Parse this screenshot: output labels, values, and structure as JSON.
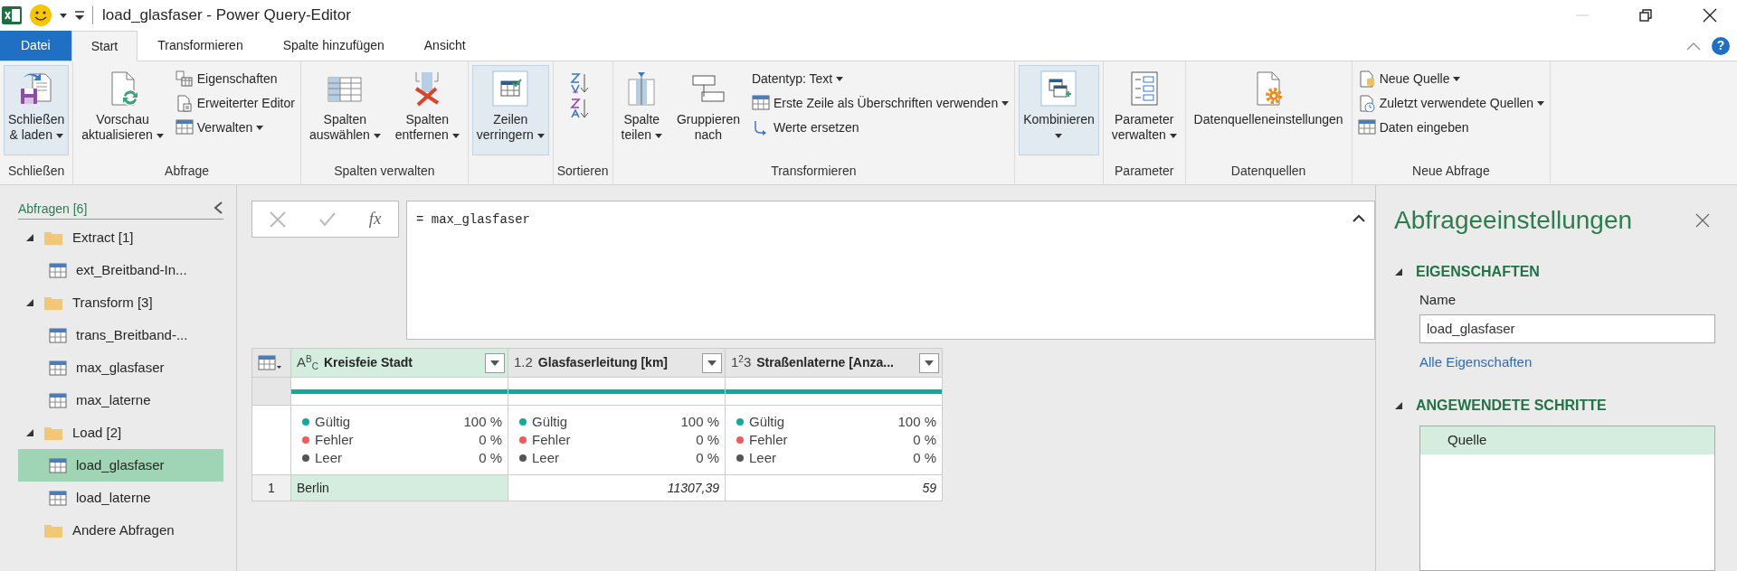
{
  "window": {
    "title": "load_glasfaser - Power Query-Editor"
  },
  "ribbon_tabs": [
    {
      "label": "Datei",
      "kind": "file",
      "selected": false
    },
    {
      "label": "Start",
      "kind": "tab",
      "selected": true
    },
    {
      "label": "Transformieren",
      "kind": "tab",
      "selected": false
    },
    {
      "label": "Spalte hinzufügen",
      "kind": "tab",
      "selected": false
    },
    {
      "label": "Ansicht",
      "kind": "tab",
      "selected": false
    }
  ],
  "help": "?",
  "ribbon_groups": [
    {
      "label": "Schließen",
      "buttons": [
        {
          "kind": "large",
          "lines": [
            "Schließen",
            "& laden"
          ],
          "dropdown": true,
          "highlighted": true
        }
      ]
    },
    {
      "label": "Abfrage",
      "buttons": [
        {
          "kind": "large",
          "lines": [
            "Vorschau",
            "aktualisieren"
          ],
          "dropdown": true,
          "highlighted": false
        },
        {
          "kind": "stack",
          "items": [
            {
              "label": "Eigenschaften",
              "dropdown": false
            },
            {
              "label": "Erweiterter Editor",
              "dropdown": false
            },
            {
              "label": "Verwalten",
              "dropdown": true
            }
          ]
        }
      ]
    },
    {
      "label": "Spalten verwalten",
      "buttons": [
        {
          "kind": "large",
          "lines": [
            "Spalten",
            "auswählen"
          ],
          "dropdown": true,
          "highlighted": false
        },
        {
          "kind": "large",
          "lines": [
            "Spalten",
            "entfernen"
          ],
          "dropdown": true,
          "highlighted": false
        }
      ]
    },
    {
      "buttons": [
        {
          "kind": "large",
          "lines": [
            "Zeilen",
            "verringern"
          ],
          "dropdown": true,
          "highlighted": true
        }
      ]
    },
    {
      "label": "Sortieren",
      "buttons": [
        {
          "kind": "sort"
        }
      ]
    },
    {
      "label": "Transformieren",
      "buttons": [
        {
          "kind": "large",
          "lines": [
            "Spalte",
            "teilen"
          ],
          "dropdown": true,
          "highlighted": false
        },
        {
          "kind": "large",
          "lines": [
            "Gruppieren",
            "nach"
          ],
          "dropdown": false,
          "highlighted": false
        },
        {
          "kind": "stack",
          "items": [
            {
              "label": "Datentyp: Text",
              "dropdown": true
            },
            {
              "label": "Erste Zeile als Überschriften verwenden",
              "dropdown": true
            },
            {
              "label": "Werte ersetzen",
              "dropdown": false
            }
          ]
        }
      ]
    },
    {
      "buttons": [
        {
          "kind": "large",
          "lines": [
            "Kombinieren"
          ],
          "dropdown": true,
          "highlighted": true
        }
      ]
    },
    {
      "label": "Parameter",
      "buttons": [
        {
          "kind": "large",
          "lines": [
            "Parameter",
            "verwalten"
          ],
          "dropdown": true,
          "highlighted": false
        }
      ]
    },
    {
      "label": "Datenquellen",
      "buttons": [
        {
          "kind": "large",
          "lines": [
            "Datenquelleneinstellungen"
          ],
          "dropdown": false,
          "highlighted": false
        }
      ]
    },
    {
      "label": "Neue Abfrage",
      "buttons": [
        {
          "kind": "stack",
          "items": [
            {
              "label": "Neue Quelle",
              "dropdown": true
            },
            {
              "label": "Zuletzt verwendete Quellen",
              "dropdown": true
            },
            {
              "label": "Daten eingeben",
              "dropdown": false
            }
          ]
        }
      ]
    }
  ],
  "queries": {
    "title": "Abfragen [6]",
    "items": [
      {
        "kind": "folder",
        "label": "Extract [1]",
        "expanded": true,
        "children": [
          {
            "kind": "query",
            "label": "ext_Breitband-In...",
            "selected": false
          }
        ]
      },
      {
        "kind": "folder",
        "label": "Transform [3]",
        "expanded": true,
        "children": [
          {
            "kind": "query",
            "label": "trans_Breitband-...",
            "selected": false
          },
          {
            "kind": "query",
            "label": "max_glasfaser",
            "selected": false
          },
          {
            "kind": "query",
            "label": "max_laterne",
            "selected": false
          }
        ]
      },
      {
        "kind": "folder",
        "label": "Load [2]",
        "expanded": true,
        "children": [
          {
            "kind": "query",
            "label": "load_glasfaser",
            "selected": true
          },
          {
            "kind": "query",
            "label": "load_laterne",
            "selected": false
          }
        ]
      },
      {
        "kind": "folder",
        "label": "Andere Abfragen",
        "expanded": false
      }
    ]
  },
  "formula_bar": {
    "fx_label": "fx",
    "formula": "= max_glasfaser"
  },
  "table": {
    "columns": [
      {
        "type_label": "A$^{B}$$_{C}$",
        "name": "Kreisfeie Stadt",
        "kind": "text",
        "selected": true,
        "level": 1,
        "stats": [
          {
            "label": "Gültig",
            "value": "100 %",
            "color": "#14a99e"
          },
          {
            "label": "Fehler",
            "value": "0 %",
            "color": "#ef5b5b"
          },
          {
            "label": "Leer",
            "value": "0 %",
            "color": "#555555"
          }
        ]
      },
      {
        "type_label": "1.2",
        "name": "Glasfaserleitung [km]",
        "kind": "number",
        "selected": false,
        "level": 1,
        "stats": [
          {
            "label": "Gültig",
            "value": "100 %",
            "color": "#14a99e"
          },
          {
            "label": "Fehler",
            "value": "0 %",
            "color": "#ef5b5b"
          },
          {
            "label": "Leer",
            "value": "0 %",
            "color": "#555555"
          }
        ]
      },
      {
        "type_label": "1$^{2}$3",
        "name": "Straßenlaterne [Anza...",
        "kind": "number",
        "selected": false,
        "level": 1,
        "stats": [
          {
            "label": "Gültig",
            "value": "100 %",
            "color": "#14a99e"
          },
          {
            "label": "Fehler",
            "value": "0 %",
            "color": "#ef5b5b"
          },
          {
            "label": "Leer",
            "value": "0 %",
            "color": "#555555"
          }
        ]
      }
    ],
    "rows": [
      {
        "number": "1",
        "cells": [
          "Berlin",
          "11307,39",
          "59"
        ]
      }
    ]
  },
  "settings": {
    "title": "Abfrageeinstellungen",
    "sections": [
      {
        "kind": "properties",
        "title": "EIGENSCHAFTEN",
        "expanded": true,
        "name_label": "Name",
        "name_value": "load_glasfaser",
        "link": "Alle Eigenschaften"
      },
      {
        "kind": "steps",
        "title": "ANGEWENDETE SCHRITTE",
        "expanded": true,
        "steps": [
          {
            "label": "Quelle",
            "selected": true
          }
        ]
      }
    ]
  }
}
